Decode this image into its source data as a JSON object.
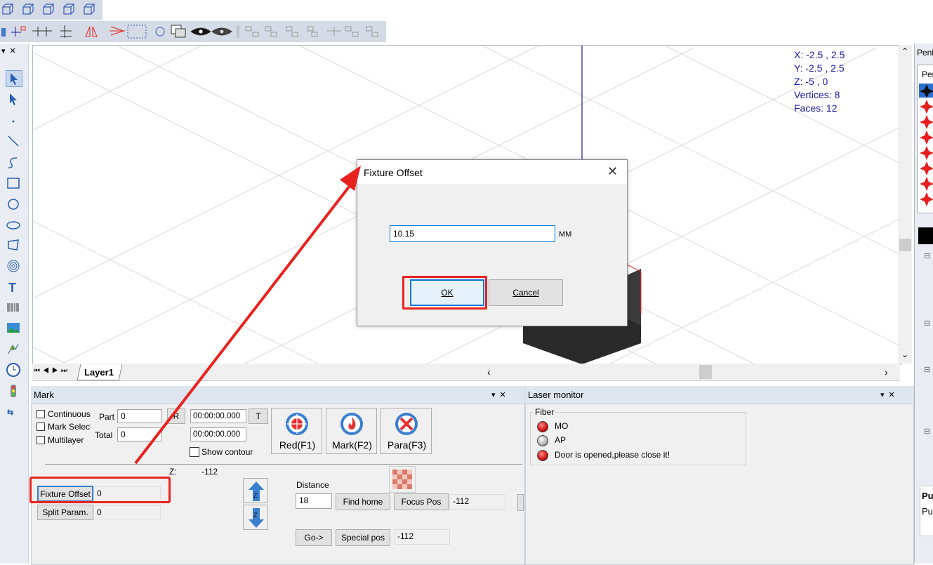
{
  "toolbar_icons": [
    "box-icon",
    "box-icon",
    "box-icon",
    "box-icon",
    "box-icon"
  ],
  "viewport": {
    "info": {
      "x": "X: -2.5 , 2.5",
      "y": "Y: -2.5 , 2.5",
      "z": "Z: -5 , 0",
      "vertices": "Vertices: 8",
      "faces": "Faces: 12"
    },
    "layer_tab": "Layer1"
  },
  "right_panel": {
    "title": "Penl",
    "tab": "Pen",
    "bottom_bold": "Pu",
    "bottom_text": "Pu"
  },
  "dialog": {
    "title": "Fixture Offset",
    "value": "10.15",
    "unit": "MM",
    "ok": "OK",
    "cancel": "Cancel"
  },
  "mark_panel": {
    "title": "Mark",
    "continuous": "Continuous",
    "mark_select": "Mark Selecte",
    "multilayer": "Multilayer",
    "part_label": "Part",
    "part_value": "0",
    "total_label": "Total",
    "total_value": "0",
    "r_button": "R",
    "t_button": "T",
    "time1": "00:00:00.000",
    "time2": "00:00:00.000",
    "show_contour": "Show contour",
    "red_button": "Red(F1)",
    "mark_button": "Mark(F2)",
    "para_button": "Para(F3)",
    "z_label": "Z:",
    "z_value": "-112",
    "fixture_offset_button": "Fixture Offset",
    "fixture_offset_value": "0",
    "split_param_button": "Split Param.",
    "split_param_value": "0",
    "distance_label": "Distance",
    "distance_value": "18",
    "find_home": "Find home",
    "focus_pos": "Focus Pos",
    "focus_value": "-112",
    "go_button": "Go->",
    "special_pos": "Special pos",
    "special_value": "-112"
  },
  "laser_monitor": {
    "title": "Laser monitor",
    "group": "Fiber",
    "items": [
      {
        "label": "MO",
        "status": "red"
      },
      {
        "label": "AP",
        "status": "gray"
      },
      {
        "label": "Door is opened,please close it!",
        "status": "red"
      }
    ]
  },
  "colors": {
    "accent_red": "#e8231f",
    "axis_blue": "#1a1aa0",
    "info_text": "#1a1aa0"
  }
}
